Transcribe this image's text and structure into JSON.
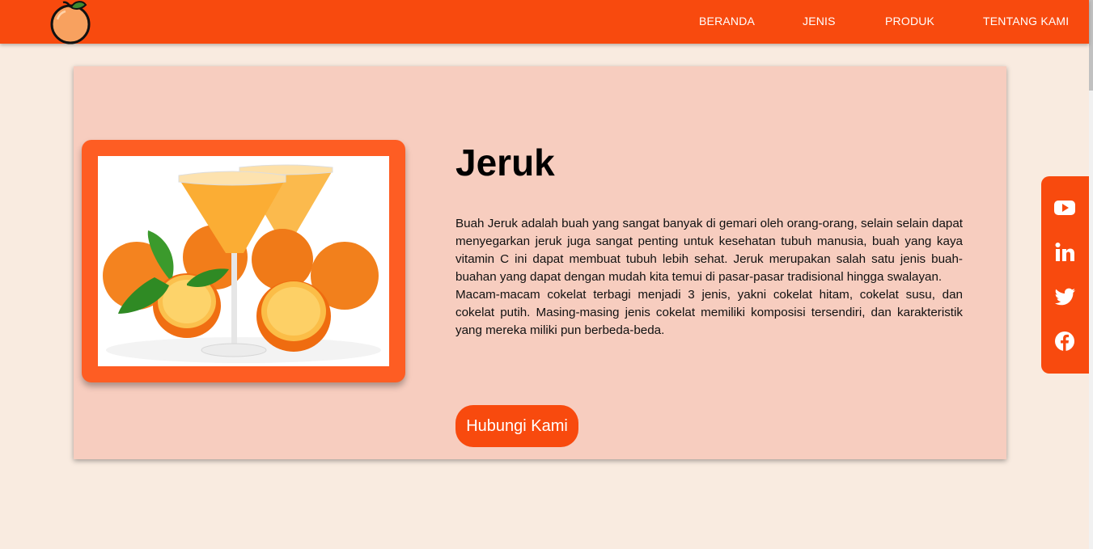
{
  "nav": {
    "items": [
      {
        "label": "BERANDA"
      },
      {
        "label": "JENIS"
      },
      {
        "label": "PRODUK"
      },
      {
        "label": "TENTANG KAMI"
      }
    ]
  },
  "hero": {
    "title": "Jeruk",
    "paragraph1": "Buah Jeruk adalah buah yang sangat banyak di gemari oleh orang-orang, selain selain dapat menyegarkan jeruk juga sangat penting untuk kesehatan tubuh manusia, buah yang kaya vitamin C ini dapat membuat tubuh lebih sehat. Jeruk merupakan salah satu jenis buah-buahan yang dapat dengan mudah kita temui di pasar-pasar tradisional hingga swalayan.",
    "paragraph2": "Macam-macam cokelat terbagi menjadi 3 jenis, yakni cokelat hitam, cokelat susu, dan cokelat putih. Masing-masing jenis cokelat memiliki komposisi tersendiri, dan karakteristik yang mereka miliki pun berbeda-beda.",
    "button_label": "Hubungi Kami"
  },
  "social": {
    "icons": [
      "youtube-icon",
      "linkedin-icon",
      "twitter-icon",
      "facebook-icon"
    ]
  },
  "colors": {
    "brand": "#f84a0e",
    "frame": "#fe5d23",
    "card": "#f7cdbf",
    "background": "#f9ebe0"
  }
}
